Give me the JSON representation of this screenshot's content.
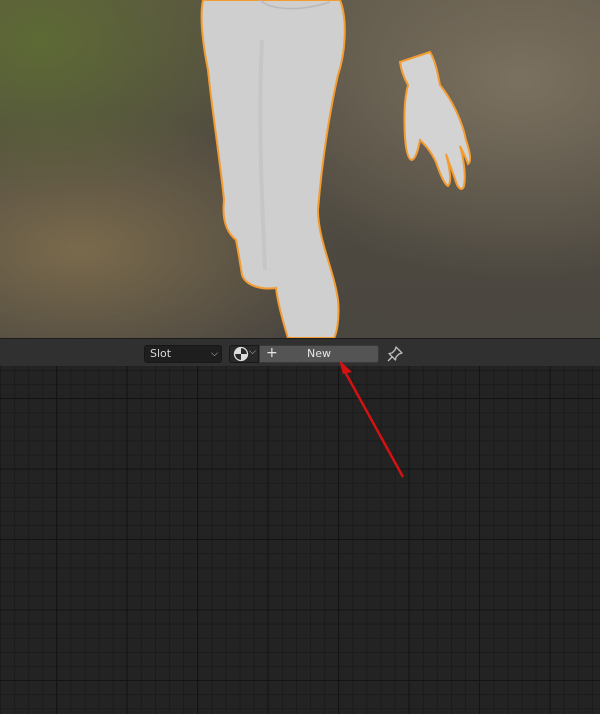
{
  "header": {
    "slot_label": "Slot",
    "new_label": "New",
    "browse_icon": "material-sphere-icon",
    "pin_icon": "pin-icon"
  },
  "colors": {
    "selection_outline": "#f39c32",
    "annotation_arrow": "#d41212",
    "header_bg": "#303030",
    "editor_bg": "#232323"
  }
}
